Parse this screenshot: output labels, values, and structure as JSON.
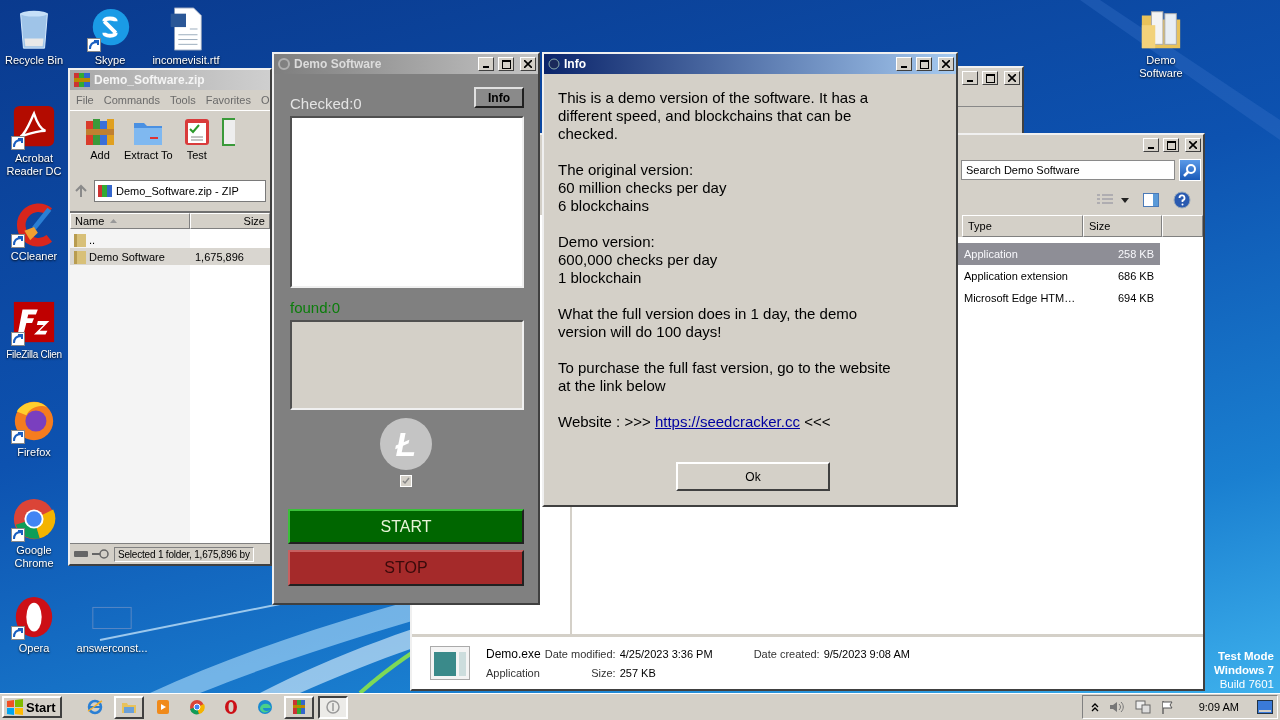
{
  "desktop_icons": [
    {
      "label": "Recycle Bin",
      "shortcut": false
    },
    {
      "label": "Skype",
      "shortcut": true
    },
    {
      "label": "incomevisit.rtf",
      "shortcut": false
    },
    {
      "label": "Acrobat Reader DC",
      "shortcut": true
    },
    {
      "label": "CCleaner",
      "shortcut": true
    },
    {
      "label": "FileZilla Clien",
      "shortcut": true
    },
    {
      "label": "Firefox",
      "shortcut": true
    },
    {
      "label": "Google Chrome",
      "shortcut": true
    },
    {
      "label": "Opera",
      "shortcut": true
    },
    {
      "label": "answerconst...",
      "shortcut": false
    },
    {
      "label": "Demo Software",
      "shortcut": false
    }
  ],
  "archive_window": {
    "title": "Demo_Software.zip",
    "menu": [
      "File",
      "Commands",
      "Tools",
      "Favorites",
      "O"
    ],
    "tools": [
      "Add",
      "Extract To",
      "Test"
    ],
    "address": "Demo_Software.zip - ZIP",
    "columns": [
      "Name",
      "Size"
    ],
    "rows": [
      {
        "name": "..",
        "selected": false
      },
      {
        "name": "Demo Software",
        "size": "1,675,896",
        "selected": true
      }
    ],
    "status": "Selected 1 folder, 1,675,896 by"
  },
  "demo_app": {
    "title": "Demo Software",
    "checked_label": "Checked:0",
    "info_button": "Info",
    "found_label": "found:0",
    "logo_glyph": "Ł",
    "option_checked": true,
    "start_button": "START",
    "stop_button": "STOP"
  },
  "info_dialog": {
    "title": "Info",
    "paragraphs": [
      "This is a demo version of the software. It has a\ndifferent speed, and blockchains that can be\nchecked.",
      "The original version:\n60 million checks per day\n6 blockchains",
      "Demo version:\n600,000 checks per day\n1 blockchain",
      "What the full version does in 1 day, the demo\nversion will do 100 days!",
      "To purchase the full fast version, go to the website\nat the link below"
    ],
    "website": {
      "label": "Website : >>>",
      "link": "https://seedcracker.cc",
      "suffix": "<<<"
    },
    "ok_button": "Ok"
  },
  "explorer": {
    "search_placeholder": "Search Demo Software",
    "columns": [
      "Type",
      "Size"
    ],
    "rows": [
      {
        "type": "Application",
        "size": "258 KB",
        "selected": true
      },
      {
        "type": "Application extension",
        "size": "686 KB",
        "selected": false
      },
      {
        "type": "Microsoft Edge HTM…",
        "size": "694 KB",
        "selected": false
      }
    ],
    "details": {
      "name": "Demo.exe",
      "file_type": "Application",
      "modified_label": "Date modified:",
      "modified": "4/25/2023 3:36 PM",
      "created_label": "Date created:",
      "created": "9/5/2023 9:08 AM",
      "size_label": "Size:",
      "size": "257 KB"
    }
  },
  "os_notice": [
    "Test Mode",
    "Windows 7",
    "Build 7601"
  ],
  "taskbar": {
    "start": "Start",
    "apps": [
      {
        "running": false,
        "selected": false
      },
      {
        "running": true,
        "selected": false
      },
      {
        "running": false,
        "selected": false
      },
      {
        "running": false,
        "selected": false
      },
      {
        "running": false,
        "selected": false
      },
      {
        "running": false,
        "selected": false
      },
      {
        "running": true,
        "selected": false
      },
      {
        "running": true,
        "selected": true
      }
    ],
    "clock": "9:09 AM"
  }
}
